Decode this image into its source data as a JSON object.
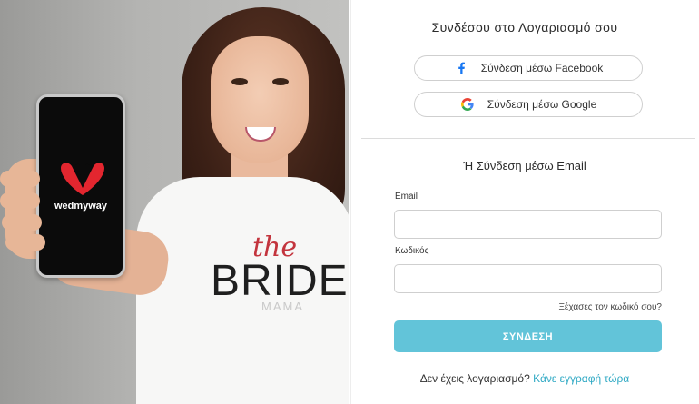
{
  "hero": {
    "phone_brand": "wedmyway",
    "shirt_print": {
      "line1": "the",
      "line2": "BRIDE",
      "line3": "MAMA"
    },
    "logo_icon": "wedmyway-heart-logo",
    "accent": "#e3262f"
  },
  "login": {
    "title": "Συνδέσου στο Λογαριασμό σου",
    "facebook": {
      "label": "Σύνδεση μέσω Facebook",
      "icon": "facebook-icon"
    },
    "google": {
      "label": "Σύνδεση μέσω Google",
      "icon": "google-icon"
    },
    "email_section_title": "Ή Σύνδεση μέσω Email",
    "email_label": "Email",
    "email_value": "",
    "password_label": "Κωδικός",
    "password_value": "",
    "forgot": "Ξέχασες τον κωδικό σου?",
    "submit": "ΣΥΝΔΕΣΗ",
    "signup_prompt": "Δεν έχεις λογαριασμό?",
    "signup_link": "Κάνε εγγραφή τώρα",
    "colors": {
      "submit": "#62c4d9",
      "link": "#2fa9c4",
      "facebook": "#1877f2"
    }
  }
}
